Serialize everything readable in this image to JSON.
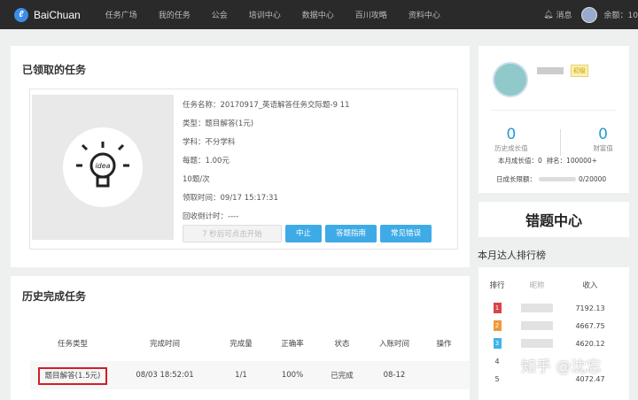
{
  "header": {
    "brand": "BaiChuan",
    "nav": [
      "任务广场",
      "我的任务",
      "公会",
      "培训中心",
      "数据中心",
      "百川攻略",
      "资料中心"
    ],
    "messages": "消息",
    "balance": "余额：10"
  },
  "task": {
    "title": "已领取的任务",
    "image_label": "idea",
    "fields": [
      "任务名称：20170917_英语解答任务交际题-9 11",
      "类型：题目解答(1元)",
      "学科：不分学科",
      "每题：1.00元",
      "10题/次",
      "领取时间：09/17 15:17:31",
      "回收倒计时：----"
    ],
    "buttons": {
      "start": "7 秒后可点击开始",
      "stop": "中止",
      "guide": "答题指南",
      "errors": "常见错误"
    }
  },
  "history": {
    "title": "历史完成任务",
    "columns": [
      "任务类型",
      "完成时间",
      "完成量",
      "正确率",
      "状态",
      "入账时间",
      "操作"
    ],
    "rows": [
      {
        "type": "题目解答(1.5元)",
        "time": "08/03 18:52:01",
        "amount": "1/1",
        "accuracy": "100%",
        "status": "已完成",
        "credited": "08-12",
        "action": ""
      }
    ]
  },
  "profile": {
    "level_badge": "初级",
    "growth_total": "0",
    "growth_total_label": "历史成长值",
    "wealth": "0",
    "wealth_label": "财富值",
    "month_growth": "本月成长值：0",
    "rank": "排名：100000+",
    "daily_cap_label": "日成长限额：",
    "daily_cap": "0/20000"
  },
  "wrong_center": "错题中心",
  "leaderboard": {
    "title": "本月达人排行榜",
    "columns": [
      "排行",
      "昵称",
      "收入"
    ],
    "rows": [
      {
        "rank": "1",
        "income": "7192.13"
      },
      {
        "rank": "2",
        "income": "4667.75"
      },
      {
        "rank": "3",
        "income": "4620.12"
      },
      {
        "rank": "4",
        "income": ""
      },
      {
        "rank": "5",
        "income": "4072.47"
      }
    ]
  },
  "watermark": "知乎 @沈忘",
  "colors": {
    "accent": "#3eabe6",
    "highlight": "#d0202a"
  }
}
